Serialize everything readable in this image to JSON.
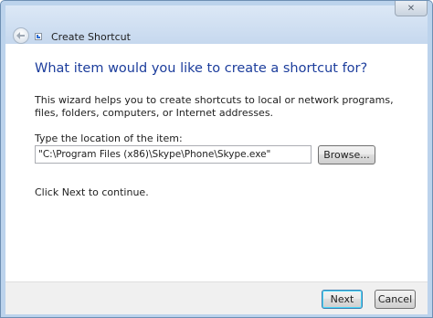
{
  "window": {
    "title": "Create Shortcut",
    "close_glyph": "✕"
  },
  "icons": {
    "back": "back-arrow-icon",
    "app": "shortcut-icon",
    "close": "close-icon"
  },
  "main": {
    "heading": "What item would you like to create a shortcut for?",
    "description": "This wizard helps you to create shortcuts to local or network programs, files, folders, computers, or Internet addresses.",
    "location_label": "Type the location of the item:",
    "location_value": "\"C:\\Program Files (x86)\\Skype\\Phone\\Skype.exe\"",
    "browse_label": "Browse...",
    "continue_text": "Click Next to continue."
  },
  "footer": {
    "next_label": "Next",
    "cancel_label": "Cancel"
  },
  "colors": {
    "heading": "#1c3d9c",
    "frame": "#bcd3ec",
    "footer": "#f0f0f0"
  }
}
